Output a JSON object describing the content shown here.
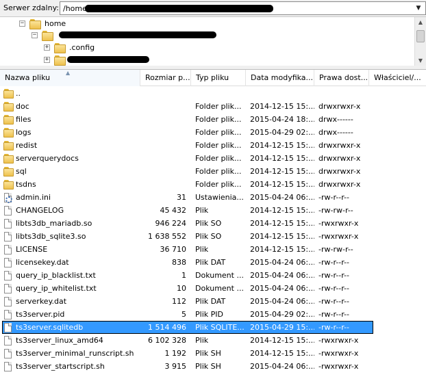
{
  "remote": {
    "label": "Serwer zdalny:",
    "path": "/home/",
    "dropdown_icon": "chevron-down-icon"
  },
  "tree": {
    "items": [
      {
        "label": "home",
        "expander": "−"
      },
      {
        "label": "",
        "expander": "−"
      },
      {
        "label": ".config",
        "expander": "+"
      },
      {
        "label": "",
        "expander": "+"
      }
    ]
  },
  "list": {
    "columns": [
      "Nazwa pliku",
      "Rozmiar p...",
      "Typ pliku",
      "Data modyfika...",
      "Prawa dost...",
      "Właściciel/..."
    ],
    "rows": [
      {
        "name": "..",
        "size": "",
        "type": "",
        "date": "",
        "perm": "",
        "icon": "folder-icon"
      },
      {
        "name": "doc",
        "size": "",
        "type": "Folder plik...",
        "date": "2014-12-15 15:...",
        "perm": "drwxrwxr-x",
        "icon": "folder-icon"
      },
      {
        "name": "files",
        "size": "",
        "type": "Folder plik...",
        "date": "2015-04-24 18:...",
        "perm": "drwx------",
        "icon": "folder-icon"
      },
      {
        "name": "logs",
        "size": "",
        "type": "Folder plik...",
        "date": "2015-04-29 02:...",
        "perm": "drwx------",
        "icon": "folder-icon"
      },
      {
        "name": "redist",
        "size": "",
        "type": "Folder plik...",
        "date": "2014-12-15 15:...",
        "perm": "drwxrwxr-x",
        "icon": "folder-icon"
      },
      {
        "name": "serverquerydocs",
        "size": "",
        "type": "Folder plik...",
        "date": "2014-12-15 15:...",
        "perm": "drwxrwxr-x",
        "icon": "folder-icon"
      },
      {
        "name": "sql",
        "size": "",
        "type": "Folder plik...",
        "date": "2014-12-15 15:...",
        "perm": "drwxrwxr-x",
        "icon": "folder-icon"
      },
      {
        "name": "tsdns",
        "size": "",
        "type": "Folder plik...",
        "date": "2014-12-15 15:...",
        "perm": "drwxrwxr-x",
        "icon": "folder-icon"
      },
      {
        "name": "admin.ini",
        "size": "31",
        "type": "Ustawienia...",
        "date": "2015-04-24 06:...",
        "perm": "-rw-r--r--",
        "icon": "settings-file-icon"
      },
      {
        "name": "CHANGELOG",
        "size": "45 432",
        "type": "Plik",
        "date": "2014-12-15 15:...",
        "perm": "-rw-rw-r--",
        "icon": "file-icon"
      },
      {
        "name": "libts3db_mariadb.so",
        "size": "946 224",
        "type": "Plik SO",
        "date": "2014-12-15 15:...",
        "perm": "-rwxrwxr-x",
        "icon": "file-icon"
      },
      {
        "name": "libts3db_sqlite3.so",
        "size": "1 638 552",
        "type": "Plik SO",
        "date": "2014-12-15 15:...",
        "perm": "-rwxrwxr-x",
        "icon": "file-icon"
      },
      {
        "name": "LICENSE",
        "size": "36 710",
        "type": "Plik",
        "date": "2014-12-15 15:...",
        "perm": "-rw-rw-r--",
        "icon": "file-icon"
      },
      {
        "name": "licensekey.dat",
        "size": "838",
        "type": "Plik DAT",
        "date": "2015-04-24 06:...",
        "perm": "-rw-r--r--",
        "icon": "file-icon"
      },
      {
        "name": "query_ip_blacklist.txt",
        "size": "1",
        "type": "Dokument ...",
        "date": "2015-04-24 06:...",
        "perm": "-rw-r--r--",
        "icon": "file-icon"
      },
      {
        "name": "query_ip_whitelist.txt",
        "size": "10",
        "type": "Dokument ...",
        "date": "2015-04-24 06:...",
        "perm": "-rw-r--r--",
        "icon": "file-icon"
      },
      {
        "name": "serverkey.dat",
        "size": "112",
        "type": "Plik DAT",
        "date": "2015-04-24 06:...",
        "perm": "-rw-r--r--",
        "icon": "file-icon"
      },
      {
        "name": "ts3server.pid",
        "size": "5",
        "type": "Plik PID",
        "date": "2015-04-29 02:...",
        "perm": "-rw-r--r--",
        "icon": "file-icon"
      },
      {
        "name": "ts3server.sqlitedb",
        "size": "1 514 496",
        "type": "Plik SQLITE...",
        "date": "2015-04-29 15:...",
        "perm": "-rw-r--r--",
        "icon": "file-icon",
        "selected": true
      },
      {
        "name": "ts3server_linux_amd64",
        "size": "6 102 328",
        "type": "Plik",
        "date": "2014-12-15 15:...",
        "perm": "-rwxrwxr-x",
        "icon": "file-icon"
      },
      {
        "name": "ts3server_minimal_runscript.sh",
        "size": "1 192",
        "type": "Plik SH",
        "date": "2014-12-15 15:...",
        "perm": "-rwxrwxr-x",
        "icon": "file-icon"
      },
      {
        "name": "ts3server_startscript.sh",
        "size": "3 915",
        "type": "Plik SH",
        "date": "2015-04-24 06:...",
        "perm": "-rwxrwxr-x",
        "icon": "file-icon"
      }
    ]
  },
  "colors": {
    "selection": "#3399ff",
    "folder": "#eec14d"
  }
}
